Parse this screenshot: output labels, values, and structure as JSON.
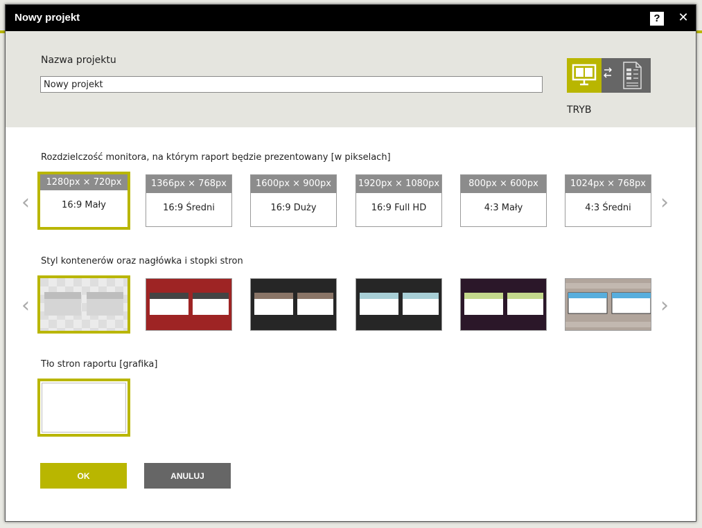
{
  "dialog": {
    "title": "Nowy projekt",
    "help_label": "?",
    "close_label": "✕"
  },
  "project": {
    "name_label": "Nazwa projektu",
    "name_value": "Nowy projekt",
    "mode_label": "TRYB"
  },
  "resolution": {
    "section_label": "Rozdzielczość monitora, na którym raport będzie prezentowany [w pikselach]",
    "options": [
      {
        "size": "1280px × 720px",
        "label": "16:9 Mały",
        "selected": true
      },
      {
        "size": "1366px × 768px",
        "label": "16:9 Średni",
        "selected": false
      },
      {
        "size": "1600px × 900px",
        "label": "16:9 Duży",
        "selected": false
      },
      {
        "size": "1920px × 1080px",
        "label": "16:9 Full HD",
        "selected": false
      },
      {
        "size": "800px × 600px",
        "label": "4:3 Mały",
        "selected": false
      },
      {
        "size": "1024px × 768px",
        "label": "4:3 Średni",
        "selected": false
      }
    ],
    "prev_icon": "chevron-left-icon",
    "next_icon": "chevron-right-icon"
  },
  "container_style": {
    "section_label": "Styl kontenerów oraz nagłówka i stopki stron",
    "styles": [
      {
        "id": "checker-gray",
        "bg": "#ebebeb",
        "header": "#bdbdbd",
        "box": "#d5d5d5",
        "selected": true
      },
      {
        "id": "red",
        "bg": "#9e2424",
        "header": "#444444",
        "box": "#ffffff",
        "selected": false
      },
      {
        "id": "dark-brown",
        "bg": "#262626",
        "header": "#8a7567",
        "box": "#ffffff",
        "selected": false
      },
      {
        "id": "dark-lightblue",
        "bg": "#262626",
        "header": "#a8cfd6",
        "box": "#ffffff",
        "selected": false
      },
      {
        "id": "purple-green",
        "bg": "#2b1729",
        "header": "#c3d88c",
        "box": "#ffffff",
        "selected": false
      },
      {
        "id": "taupe-blue",
        "bg": "#b1a59c",
        "header": "#58aedd",
        "box": "#ffffff",
        "selected": false
      }
    ]
  },
  "background": {
    "section_label": "Tło stron raportu [grafika]"
  },
  "buttons": {
    "ok_label": "OK",
    "cancel_label": "ANULUJ"
  },
  "colors": {
    "accent": "#b9b600",
    "dark_button": "#666666",
    "titlebar": "#000000",
    "panel": "#e5e5df"
  }
}
